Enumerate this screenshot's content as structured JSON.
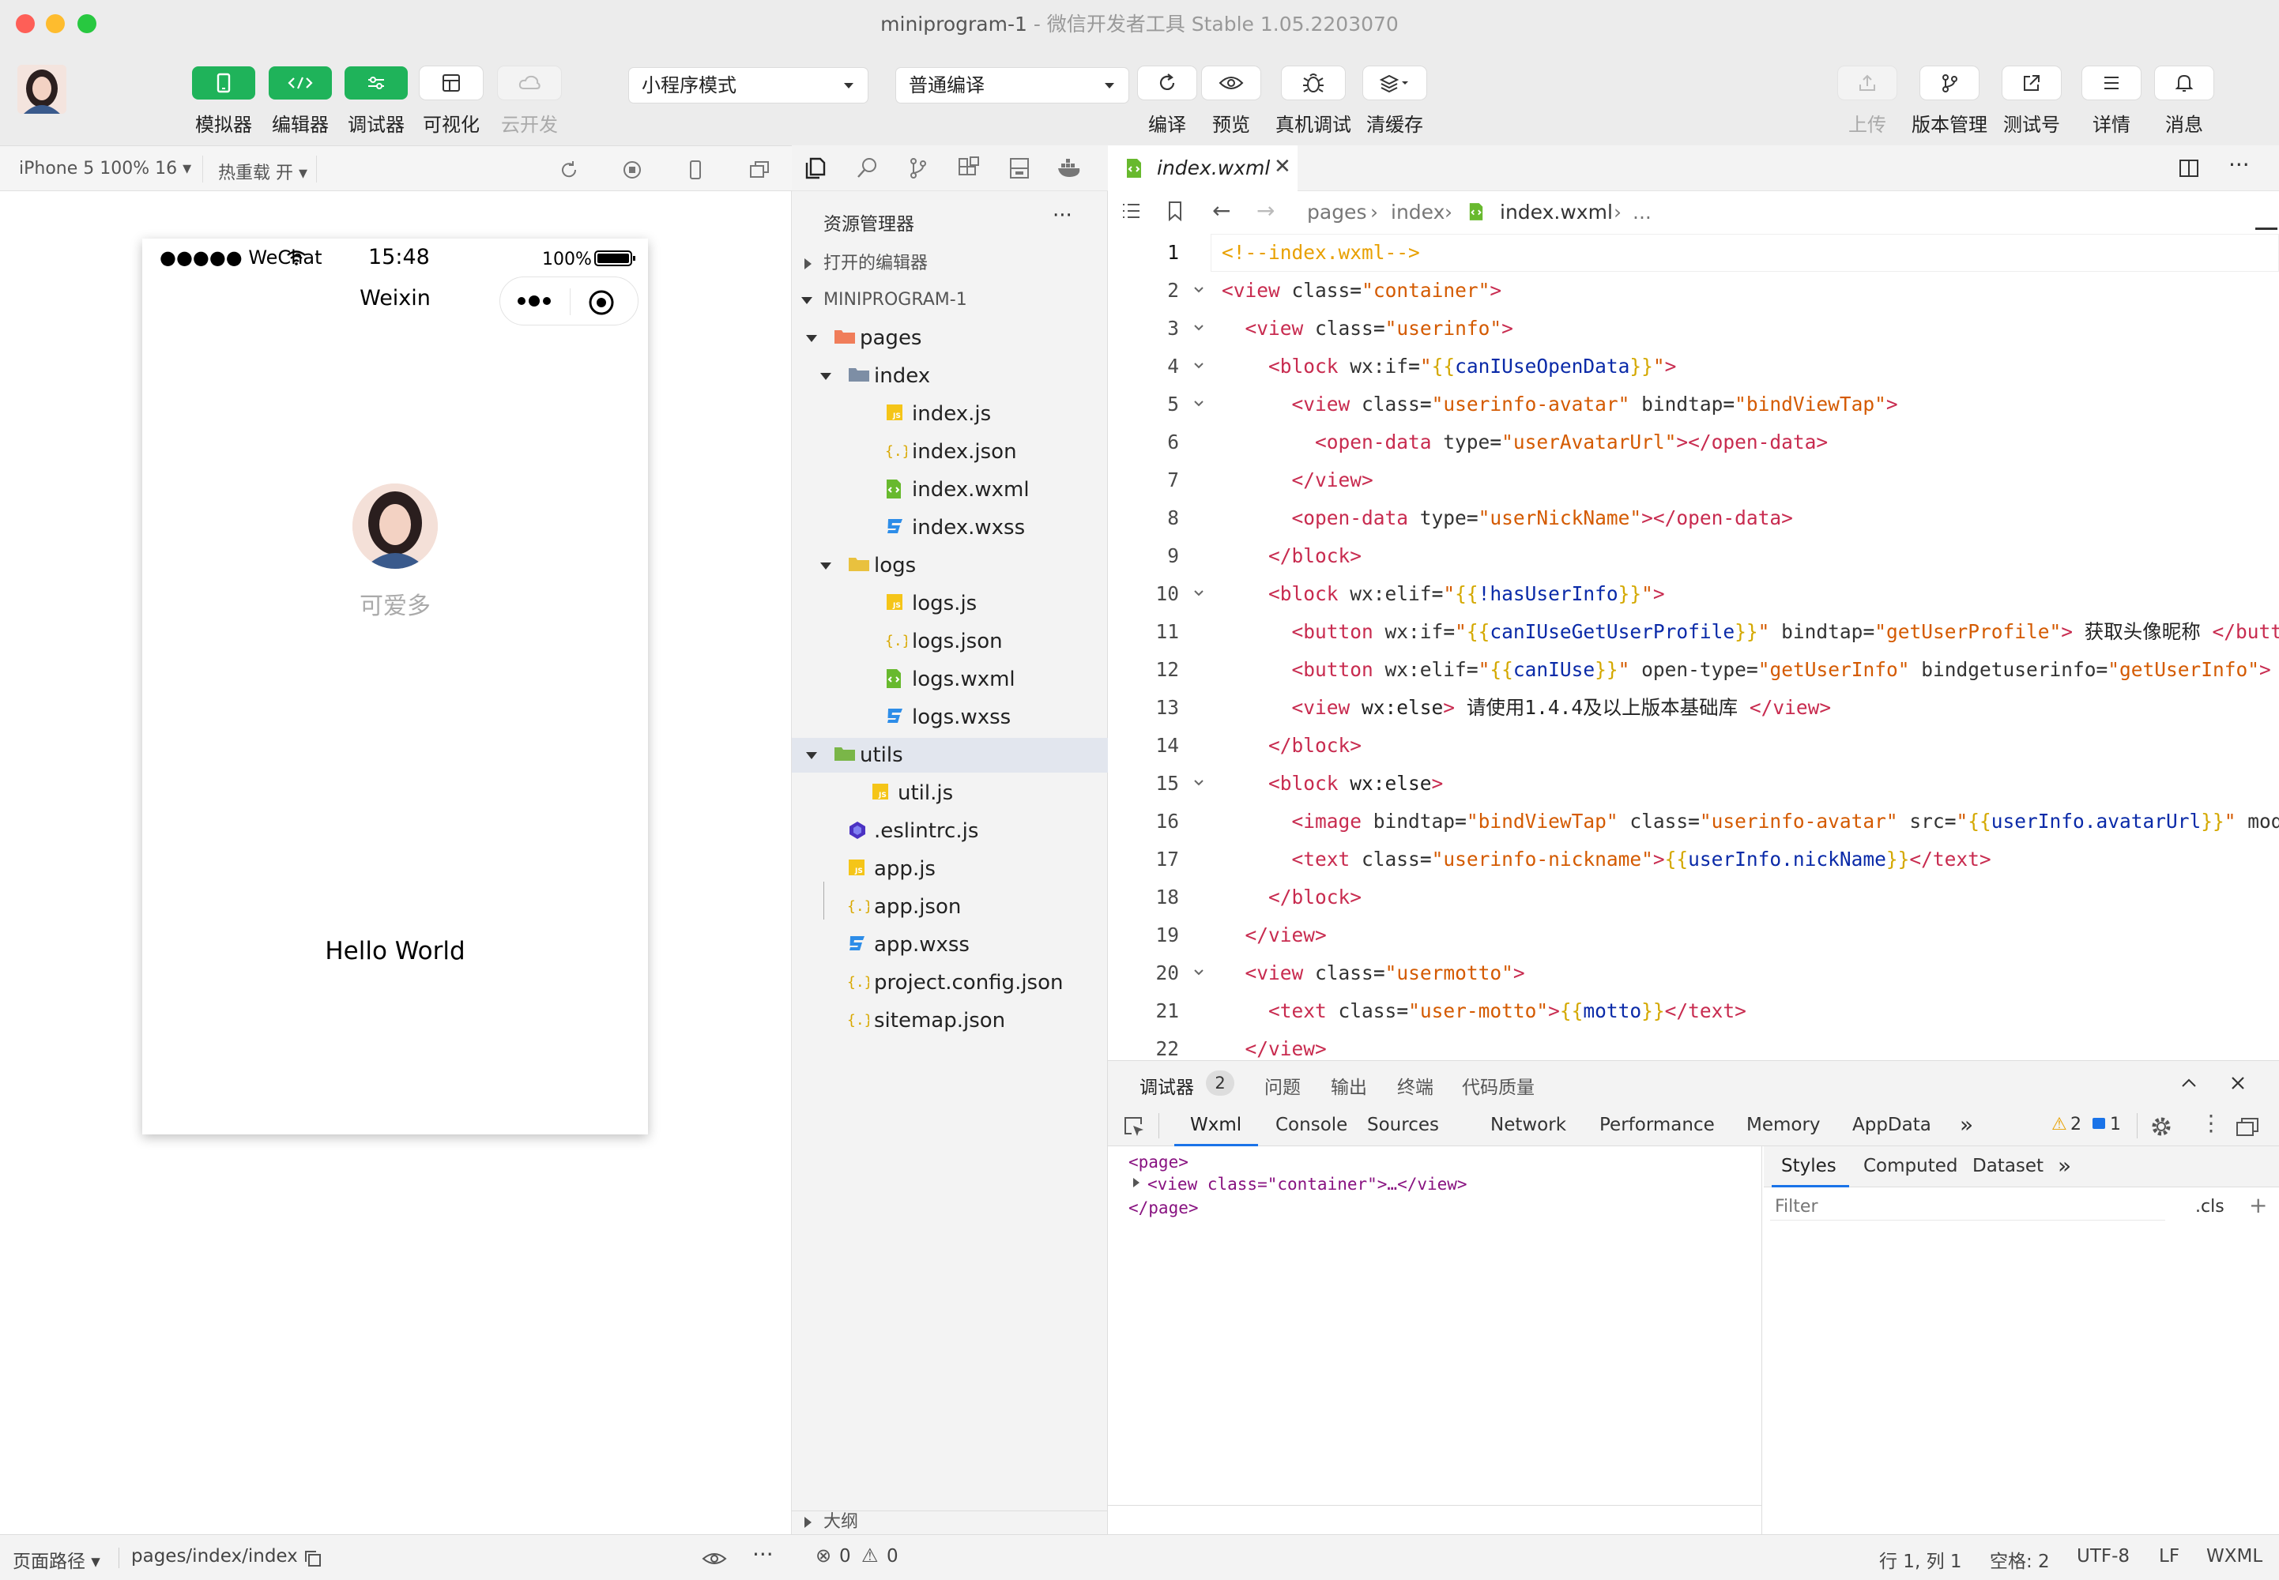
{
  "window": {
    "title": "miniprogram-1",
    "subtitle": "- 微信开发者工具 Stable 1.05.2203070"
  },
  "toolbar": {
    "buttons": [
      {
        "label": "模拟器"
      },
      {
        "label": "编辑器"
      },
      {
        "label": "调试器"
      },
      {
        "label": "可视化"
      },
      {
        "label": "云开发"
      }
    ],
    "mode_select": "小程序模式",
    "compile_select": "普通编译",
    "actions": [
      {
        "label": "编译"
      },
      {
        "label": "预览"
      },
      {
        "label": "真机调试"
      },
      {
        "label": "清缓存"
      }
    ],
    "right": [
      {
        "label": "上传"
      },
      {
        "label": "版本管理"
      },
      {
        "label": "测试号"
      },
      {
        "label": "详情"
      },
      {
        "label": "消息"
      }
    ]
  },
  "simulator": {
    "device": "iPhone 5 100% 16 ▾",
    "hot_reload": "热重载 开 ▾",
    "status_carrier": "●●●●● WeChat",
    "status_time": "15:48",
    "status_battery": "100%",
    "nav_title": "Weixin",
    "nickname": "可爱多",
    "motto": "Hello World"
  },
  "explorer": {
    "title": "资源管理器",
    "more": "···",
    "open_editors": "打开的编辑器",
    "project": "MINIPROGRAM-1",
    "tree": [
      {
        "label": "pages"
      },
      {
        "label": "index"
      },
      {
        "label": "index.js"
      },
      {
        "label": "index.json"
      },
      {
        "label": "index.wxml"
      },
      {
        "label": "index.wxss"
      },
      {
        "label": "logs"
      },
      {
        "label": "logs.js"
      },
      {
        "label": "logs.json"
      },
      {
        "label": "logs.wxml"
      },
      {
        "label": "logs.wxss"
      },
      {
        "label": "utils"
      },
      {
        "label": "util.js"
      },
      {
        "label": ".eslintrc.js"
      },
      {
        "label": "app.js"
      },
      {
        "label": "app.json"
      },
      {
        "label": "app.wxss"
      },
      {
        "label": "project.config.json"
      },
      {
        "label": "sitemap.json"
      }
    ],
    "outline": "大纲"
  },
  "editor": {
    "tab": "index.wxml",
    "breadcrumb": [
      "pages",
      "index",
      "index.wxml",
      "..."
    ],
    "lines": [
      "<!--index.wxml-->",
      "<view class=\"container\">",
      "  <view class=\"userinfo\">",
      "    <block wx:if=\"{{canIUseOpenData}}\">",
      "      <view class=\"userinfo-avatar\" bindtap=\"bindViewTap\">",
      "        <open-data type=\"userAvatarUrl\"></open-data>",
      "      </view>",
      "      <open-data type=\"userNickName\"></open-data>",
      "    </block>",
      "    <block wx:elif=\"{{!hasUserInfo}}\">",
      "      <button wx:if=\"{{canIUseGetUserProfile}}\" bindtap=\"getUserProfile\"> 获取头像昵称 </button>",
      "      <button wx:elif=\"{{canIUse}}\" open-type=\"getUserInfo\" bindgetuserinfo=\"getUserInfo\"> 获",
      "      <view wx:else> 请使用1.4.4及以上版本基础库 </view>",
      "    </block>",
      "    <block wx:else>",
      "      <image bindtap=\"bindViewTap\" class=\"userinfo-avatar\" src=\"{{userInfo.avatarUrl}}\" mode=",
      "      <text class=\"userinfo-nickname\">{{userInfo.nickName}}</text>",
      "    </block>",
      "  </view>",
      "  <view class=\"usermotto\">",
      "    <text class=\"user-motto\">{{motto}}</text>",
      "  </view>"
    ]
  },
  "devtools": {
    "panel_tabs": [
      {
        "label": "调试器"
      },
      {
        "label": "问题"
      },
      {
        "label": "输出"
      },
      {
        "label": "终端"
      },
      {
        "label": "代码质量"
      }
    ],
    "debugger_badge": "2",
    "tabs": [
      {
        "label": "Wxml"
      },
      {
        "label": "Console"
      },
      {
        "label": "Sources"
      },
      {
        "label": "Network"
      },
      {
        "label": "Performance"
      },
      {
        "label": "Memory"
      },
      {
        "label": "AppData"
      }
    ],
    "more": "»",
    "warnings": "2",
    "infos": "1",
    "dom": [
      "<page>",
      "<view class=\"container\">…</view>",
      "</page>"
    ],
    "styles_tabs": [
      {
        "label": "Styles"
      },
      {
        "label": "Computed"
      },
      {
        "label": "Dataset"
      }
    ],
    "filter_placeholder": "Filter",
    "cls": ".cls",
    "plus": "+"
  },
  "status": {
    "page_path_label": "页面路径 ▾",
    "page_path": "pages/index/index",
    "errors": "0",
    "warnings": "0",
    "cursor": "行 1, 列 1",
    "spaces": "空格: 2",
    "encoding": "UTF-8",
    "eol": "LF",
    "language": "WXML"
  },
  "colors": {
    "accent": "#1fb35a",
    "tag": "#c82b4f",
    "string": "#d45a00",
    "variable": "#0a2aa8"
  }
}
